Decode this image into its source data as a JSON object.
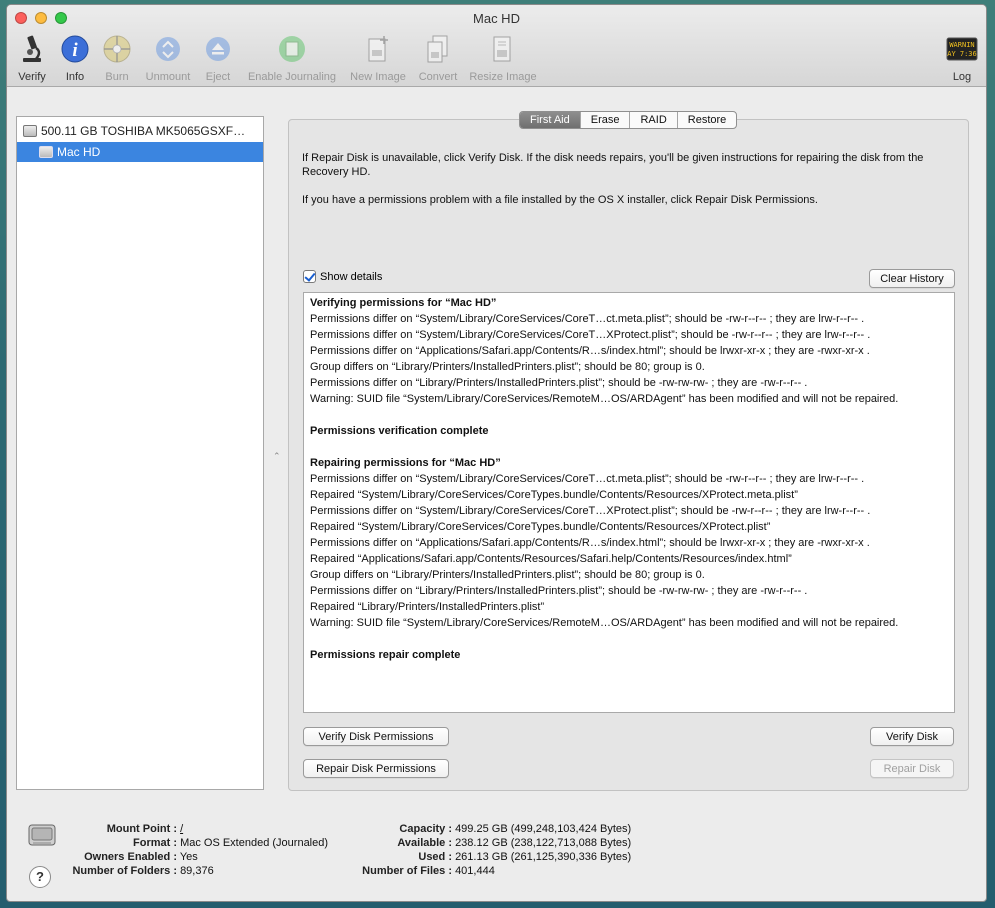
{
  "window": {
    "title": "Mac HD"
  },
  "toolbar": {
    "items": [
      {
        "label": "Verify",
        "icon": "microscope-icon",
        "enabled": true
      },
      {
        "label": "Info",
        "icon": "info-icon",
        "enabled": true
      },
      {
        "label": "Burn",
        "icon": "burn-icon",
        "enabled": false
      },
      {
        "label": "Unmount",
        "icon": "unmount-icon",
        "enabled": false
      },
      {
        "label": "Eject",
        "icon": "eject-icon",
        "enabled": false
      },
      {
        "label": "Enable Journaling",
        "icon": "journaling-icon",
        "enabled": false
      },
      {
        "label": "New Image",
        "icon": "new-image-icon",
        "enabled": false
      },
      {
        "label": "Convert",
        "icon": "convert-icon",
        "enabled": false
      },
      {
        "label": "Resize Image",
        "icon": "resize-image-icon",
        "enabled": false
      }
    ],
    "log": {
      "label": "Log",
      "icon_text_line1": "WARNIN",
      "icon_text_line2": "AY 7:36"
    }
  },
  "sidebar": {
    "disk": "500.11 GB TOSHIBA MK5065GSXF…",
    "volume": "Mac HD"
  },
  "tabs": [
    "First Aid",
    "Erase",
    "RAID",
    "Restore"
  ],
  "first_aid": {
    "info1": "If Repair Disk is unavailable, click Verify Disk. If the disk needs repairs, you'll be given instructions for repairing the disk from the Recovery HD.",
    "info2": "If you have a permissions problem with a file installed by the OS X installer, click Repair Disk Permissions.",
    "show_details": "Show details",
    "clear_history": "Clear History",
    "verify_permissions": "Verify Disk Permissions",
    "repair_permissions": "Repair Disk Permissions",
    "verify_disk": "Verify Disk",
    "repair_disk": "Repair Disk",
    "log": [
      {
        "text": "Verifying permissions for “Mac HD”",
        "bold": true
      },
      {
        "text": "Permissions differ on “System/Library/CoreServices/CoreT…ct.meta.plist”; should be -rw-r--r-- ; they are lrw-r--r-- .",
        "bold": false
      },
      {
        "text": "Permissions differ on “System/Library/CoreServices/CoreT…XProtect.plist”; should be -rw-r--r-- ; they are lrw-r--r-- .",
        "bold": false
      },
      {
        "text": "Permissions differ on “Applications/Safari.app/Contents/R…s/index.html”; should be lrwxr-xr-x ; they are -rwxr-xr-x .",
        "bold": false
      },
      {
        "text": "Group differs on “Library/Printers/InstalledPrinters.plist”; should be 80; group is 0.",
        "bold": false
      },
      {
        "text": "Permissions differ on “Library/Printers/InstalledPrinters.plist”; should be -rw-rw-rw- ; they are -rw-r--r-- .",
        "bold": false
      },
      {
        "text": "Warning: SUID file “System/Library/CoreServices/RemoteM…OS/ARDAgent” has been modified and will not be repaired.",
        "bold": false
      },
      {
        "text": "",
        "bold": false
      },
      {
        "text": "Permissions verification complete",
        "bold": true
      },
      {
        "text": "",
        "bold": false
      },
      {
        "text": "Repairing permissions for “Mac HD”",
        "bold": true
      },
      {
        "text": "Permissions differ on “System/Library/CoreServices/CoreT…ct.meta.plist”; should be -rw-r--r-- ; they are lrw-r--r-- .",
        "bold": false
      },
      {
        "text": "Repaired “System/Library/CoreServices/CoreTypes.bundle/Contents/Resources/XProtect.meta.plist”",
        "bold": false
      },
      {
        "text": "Permissions differ on “System/Library/CoreServices/CoreT…XProtect.plist”; should be -rw-r--r-- ; they are lrw-r--r-- .",
        "bold": false
      },
      {
        "text": "Repaired “System/Library/CoreServices/CoreTypes.bundle/Contents/Resources/XProtect.plist”",
        "bold": false
      },
      {
        "text": "Permissions differ on “Applications/Safari.app/Contents/R…s/index.html”; should be lrwxr-xr-x ; they are -rwxr-xr-x .",
        "bold": false
      },
      {
        "text": "Repaired “Applications/Safari.app/Contents/Resources/Safari.help/Contents/Resources/index.html”",
        "bold": false
      },
      {
        "text": "Group differs on “Library/Printers/InstalledPrinters.plist”; should be 80; group is 0.",
        "bold": false
      },
      {
        "text": "Permissions differ on “Library/Printers/InstalledPrinters.plist”; should be -rw-rw-rw- ; they are -rw-r--r-- .",
        "bold": false
      },
      {
        "text": "Repaired “Library/Printers/InstalledPrinters.plist”",
        "bold": false
      },
      {
        "text": "Warning: SUID file “System/Library/CoreServices/RemoteM…OS/ARDAgent” has been modified and will not be repaired.",
        "bold": false
      },
      {
        "text": "",
        "bold": false
      },
      {
        "text": "Permissions repair complete",
        "bold": true
      }
    ]
  },
  "footer": {
    "left": [
      {
        "key": "Mount Point :",
        "value": "/"
      },
      {
        "key": "Format :",
        "value": "Mac OS Extended (Journaled)"
      },
      {
        "key": "Owners Enabled :",
        "value": "Yes"
      },
      {
        "key": "Number of Folders :",
        "value": "89,376"
      }
    ],
    "right": [
      {
        "key": "Capacity :",
        "value": "499.25 GB (499,248,103,424 Bytes)"
      },
      {
        "key": "Available :",
        "value": "238.12 GB (238,122,713,088 Bytes)"
      },
      {
        "key": "Used :",
        "value": "261.13 GB (261,125,390,336 Bytes)"
      },
      {
        "key": "Number of Files :",
        "value": "401,444"
      }
    ],
    "help": "?"
  }
}
